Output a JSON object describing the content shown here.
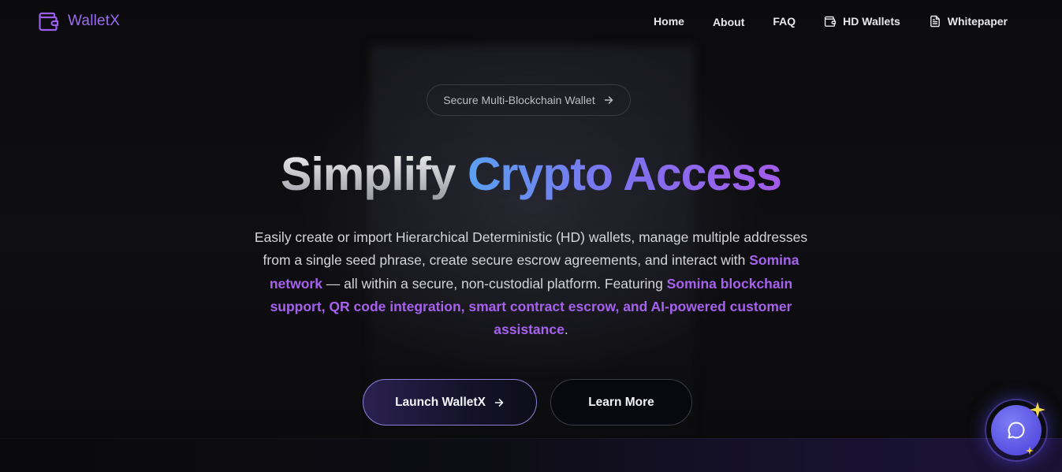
{
  "brand": {
    "name": "WalletX",
    "icon": "wallet-icon",
    "color": "#9b6cf0"
  },
  "nav": {
    "items": [
      {
        "label": "Home",
        "icon": ""
      },
      {
        "label": "About",
        "icon": ""
      },
      {
        "label": "FAQ",
        "icon": ""
      },
      {
        "label": "HD Wallets",
        "icon": "wallet-icon"
      },
      {
        "label": "Whitepaper",
        "icon": "document-icon"
      }
    ]
  },
  "hero": {
    "badge": "Secure Multi-Blockchain Wallet",
    "title_part1": "Simplify",
    "title_part2": "Crypto Access",
    "desc_1": "Easily create or import Hierarchical Deterministic (HD) wallets, manage multiple addresses from a single seed phrase, create secure escrow agreements, and interact with ",
    "desc_hl1": "Somina network",
    "desc_2": " — all within a secure, non-custodial platform. Featuring ",
    "desc_hl2": "Somina blockchain support, QR code integration, smart contract escrow, and AI-powered customer assistance",
    "desc_3": ".",
    "primary_button": "Launch WalletX",
    "secondary_button": "Learn More"
  },
  "chat_widget": {
    "icon": "chat-bubble-icon",
    "accent": "#5d56e4"
  },
  "colors": {
    "accent_purple": "#a662ee",
    "accent_blue": "#5aa0f2",
    "background": "#0b0b0d"
  }
}
